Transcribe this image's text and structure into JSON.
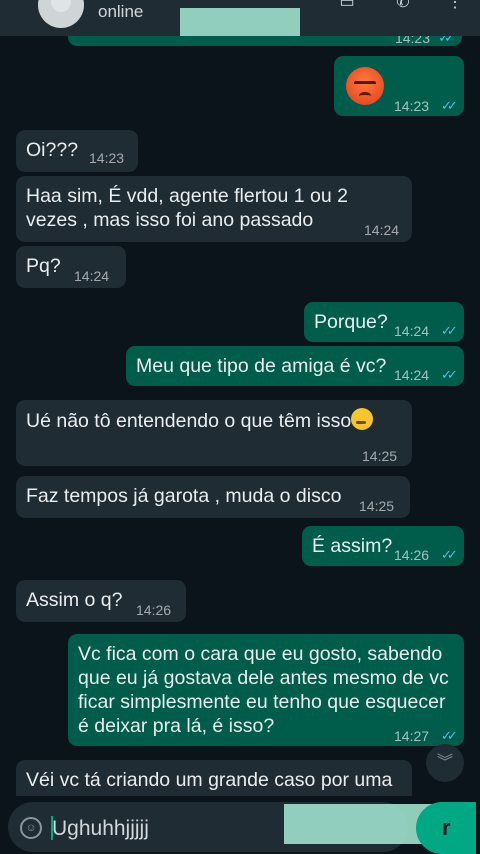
{
  "header": {
    "status": "online"
  },
  "messages": [
    {
      "id": "m0",
      "dir": "out",
      "text": "",
      "time": "14:23"
    },
    {
      "id": "m1",
      "dir": "out",
      "emoji": "angry-face",
      "text": "",
      "time": "14:23"
    },
    {
      "id": "m2",
      "dir": "in",
      "text": "Oi???",
      "time": "14:23"
    },
    {
      "id": "m3",
      "dir": "in",
      "text": "Haa sim, É vdd, agente flertou 1 ou 2 vezes , mas isso foi ano passado",
      "time": "14:24"
    },
    {
      "id": "m4",
      "dir": "in",
      "text": "Pq?",
      "time": "14:24"
    },
    {
      "id": "m5",
      "dir": "out",
      "text": "Porque?",
      "time": "14:24"
    },
    {
      "id": "m6",
      "dir": "out",
      "text": "Meu que tipo de amiga é vc?",
      "time": "14:24"
    },
    {
      "id": "m7",
      "dir": "in",
      "text": "Ué não tô entendendo o que têm isso",
      "emoji": "thinking-face",
      "time": "14:25"
    },
    {
      "id": "m8",
      "dir": "in",
      "text": "Faz tempos já garota , muda o disco",
      "time": "14:25"
    },
    {
      "id": "m9",
      "dir": "out",
      "text": "É assim?",
      "time": "14:26"
    },
    {
      "id": "m10",
      "dir": "in",
      "text": "Assim o q?",
      "time": "14:26"
    },
    {
      "id": "m11",
      "dir": "out",
      "text": "Vc fica com o cara que eu gosto, sabendo que eu já gostava dele antes mesmo de vc ficar simplesmente eu tenho que esquecer é deixar pra lá,  é isso?",
      "time": "14:27"
    },
    {
      "id": "m12",
      "dir": "in",
      "text": "Véi vc tá criando um grande caso por uma",
      "time": ""
    }
  ],
  "composer": {
    "value": "Ughuhhjjjjj",
    "send_glyph": "r"
  },
  "colors": {
    "background": "#0b141a",
    "incoming_bubble": "#1f2c34",
    "outgoing_bubble": "#005c4b",
    "read_ticks": "#53bdeb",
    "accent": "#00a884"
  },
  "icons": {
    "video": "video-call-icon",
    "call": "phone-icon",
    "menu": "more-options-icon",
    "scroll": "chevrons-down-icon",
    "emoji": "emoji-icon"
  }
}
